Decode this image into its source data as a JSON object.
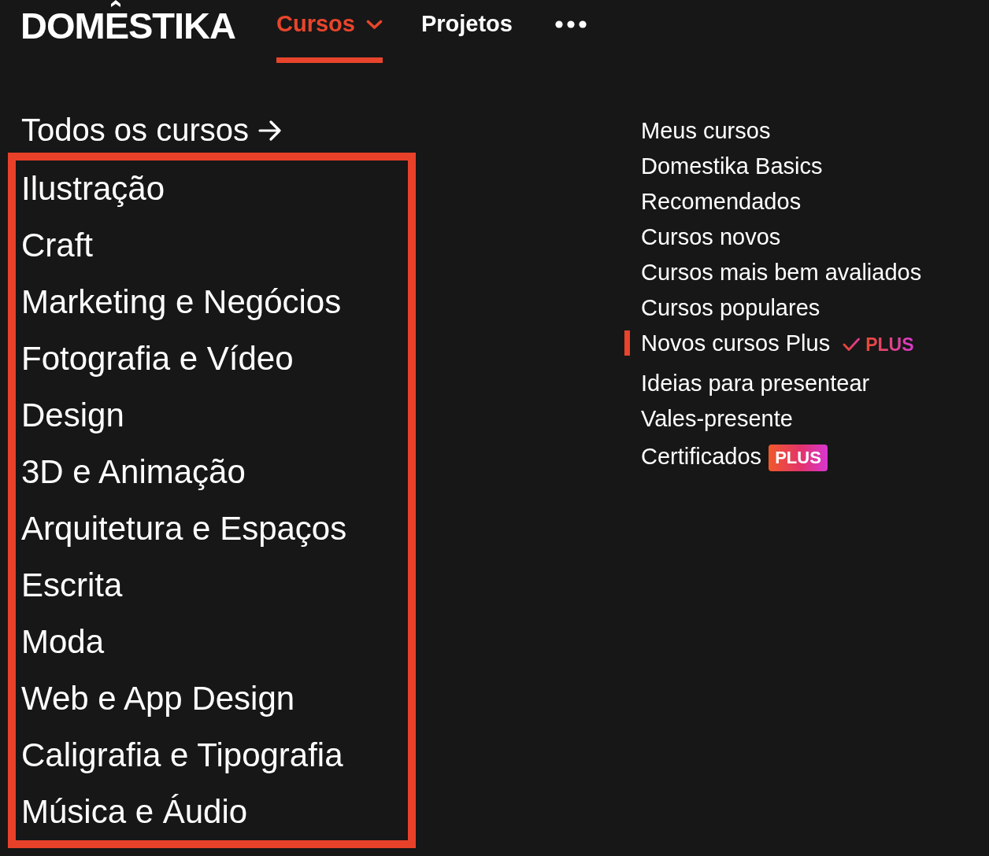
{
  "logo": {
    "text": "DOMESTIKA"
  },
  "nav": [
    {
      "kind": "dropdown",
      "label": "Cursos",
      "selected": true
    },
    {
      "kind": "link",
      "label": "Projetos",
      "selected": false
    },
    {
      "kind": "more",
      "selected": false
    }
  ],
  "all_courses": {
    "label": "Todos os cursos"
  },
  "categories": {
    "highlighted": true,
    "items": [
      "Ilustração",
      "Craft",
      "Marketing e Negócios",
      "Fotografia e Vídeo",
      "Design",
      "3D e Animação",
      "Arquitetura e Espaços",
      "Escrita",
      "Moda",
      "Web e App Design",
      "Caligrafia e Tipografia",
      "Música e Áudio"
    ]
  },
  "quick_links": [
    {
      "label": "Meus cursos",
      "selected": false
    },
    {
      "label": "Domestika Basics",
      "selected": false
    },
    {
      "label": "Recomendados",
      "selected": false
    },
    {
      "label": "Cursos novos",
      "selected": false
    },
    {
      "label": "Cursos mais bem avaliados",
      "selected": false
    },
    {
      "label": "Cursos populares",
      "selected": false
    },
    {
      "label": "Novos cursos Plus",
      "selected": true,
      "badge": {
        "kind": "check-logo",
        "text": "PLUS"
      }
    },
    {
      "label": "Ideias para presentear",
      "selected": false
    },
    {
      "label": "Vales-presente",
      "selected": false
    },
    {
      "label": "Certificados",
      "selected": false,
      "badge": {
        "kind": "pill",
        "text": "PLUS"
      }
    }
  ]
}
